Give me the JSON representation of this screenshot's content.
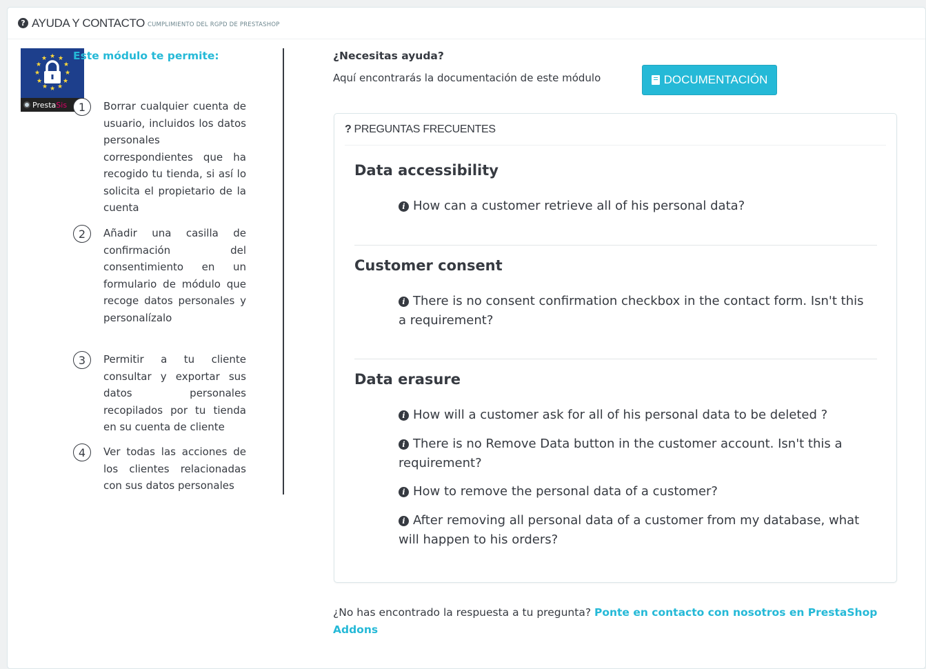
{
  "header": {
    "icon": "question-circle-icon",
    "title": "AYUDA Y CONTACTO",
    "subtitle": "CUMPLIMIENTO DEL RGPD DE PRESTASHOP"
  },
  "module": {
    "logo_text_presta": "Presta",
    "logo_text_sis": "Sis",
    "intro": "Este módulo te permite:",
    "features": [
      {
        "number": "1",
        "text": "Borrar cualquier cuenta de usuario, incluidos los datos personales correspondientes que ha recogido tu tienda, si así lo solicita el propietario de la cuenta"
      },
      {
        "number": "2",
        "text": "Añadir una casilla de confirmación del consentimiento en un formulario de módulo que recoge datos personales y personalízalo"
      },
      {
        "number": "3",
        "text": "Permitir a tu cliente consultar y exportar sus datos personales recopilados por tu tienda en su cuenta de cliente"
      },
      {
        "number": "4",
        "text": "Ver todas las acciones de los clientes relacionadas con sus datos personales"
      }
    ]
  },
  "help": {
    "title": "¿Necesitas ayuda?",
    "text": "Aquí encontrarás la documentación de este módulo",
    "doc_button": "DOCUMENTACIÓN"
  },
  "faq": {
    "heading_mark": "?",
    "heading": "PREGUNTAS FRECUENTES",
    "categories": [
      {
        "title": "Data accessibility",
        "questions": [
          "How can a customer retrieve all of his personal data?"
        ]
      },
      {
        "title": "Customer consent",
        "questions": [
          "There is no consent confirmation checkbox in the contact form. Isn't this a requirement?"
        ]
      },
      {
        "title": "Data erasure",
        "questions": [
          "How will a customer ask for all of his personal data to be deleted ?",
          "There is no Remove Data button in the customer account. Isn't this a requirement?",
          "How to remove the personal data of a customer?",
          "After removing all personal data of a customer from my database, what will happen to his orders?"
        ]
      }
    ]
  },
  "footer": {
    "text": "¿No has encontrado la respuesta a tu pregunta?",
    "link": "Ponte en contacto con nosotros en PrestaShop Addons"
  },
  "colors": {
    "accent": "#25b9d7",
    "text": "#363a41",
    "page_bg": "#eff1f2",
    "logo_bg": "#1d3f8c"
  }
}
